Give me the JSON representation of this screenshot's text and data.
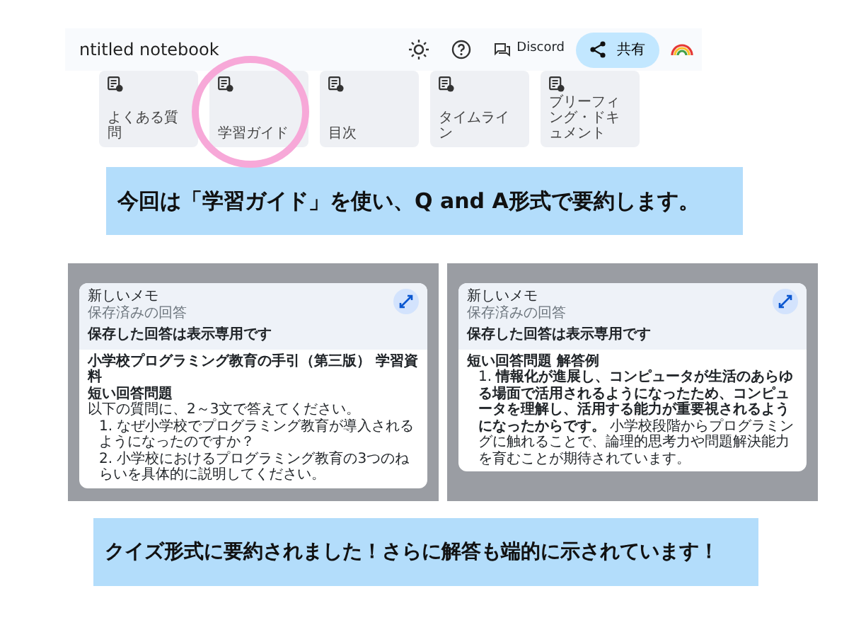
{
  "notebook": {
    "title": "ntitled notebook",
    "discord_label": "Discord",
    "share_label": "共有",
    "cards": [
      {
        "label": "よくある質問",
        "circled": false
      },
      {
        "label": "学習ガイド",
        "circled": true
      },
      {
        "label": "目次",
        "circled": false
      },
      {
        "label": "タイムライン",
        "circled": false
      },
      {
        "label": "ブリーフィング・ドキュメント",
        "circled": false
      }
    ]
  },
  "caption_top": "今回は「学習ガイド」を使い、Q and A形式で要約します。",
  "screenshots": [
    {
      "note_title": "新しいメモ",
      "note_subtitle": "保存済みの回答",
      "notice": "保存した回答は表示専用です",
      "heading": "小学校プログラミング教育の手引（第三版） 学習資料",
      "subheading": "短い回答問題",
      "intro": "以下の質問に、2～3文で答えてください。",
      "items": [
        "1. なぜ小学校でプログラミング教育が導入されるようになったのですか？",
        "2. 小学校におけるプログラミング教育の3つのねらいを具体的に説明してください。"
      ]
    },
    {
      "note_title": "新しいメモ",
      "note_subtitle": "保存済みの回答",
      "notice": "保存した回答は表示専用です",
      "subheading": "短い回答問題 解答例",
      "items": [
        "1. **情報化が進展し、コンピュータが生活のあらゆる場面で活用されるようになったため、コンピュータを理解し、活用する能力が重要視されるようになったからです。** 小学校段階からプログラミングに触れることで、論理的思考力や問題解決能力を育むことが期待されています。"
      ]
    }
  ],
  "caption_bottom": "クイズ形式に要約されました！さらに解答も端的に示されています！"
}
